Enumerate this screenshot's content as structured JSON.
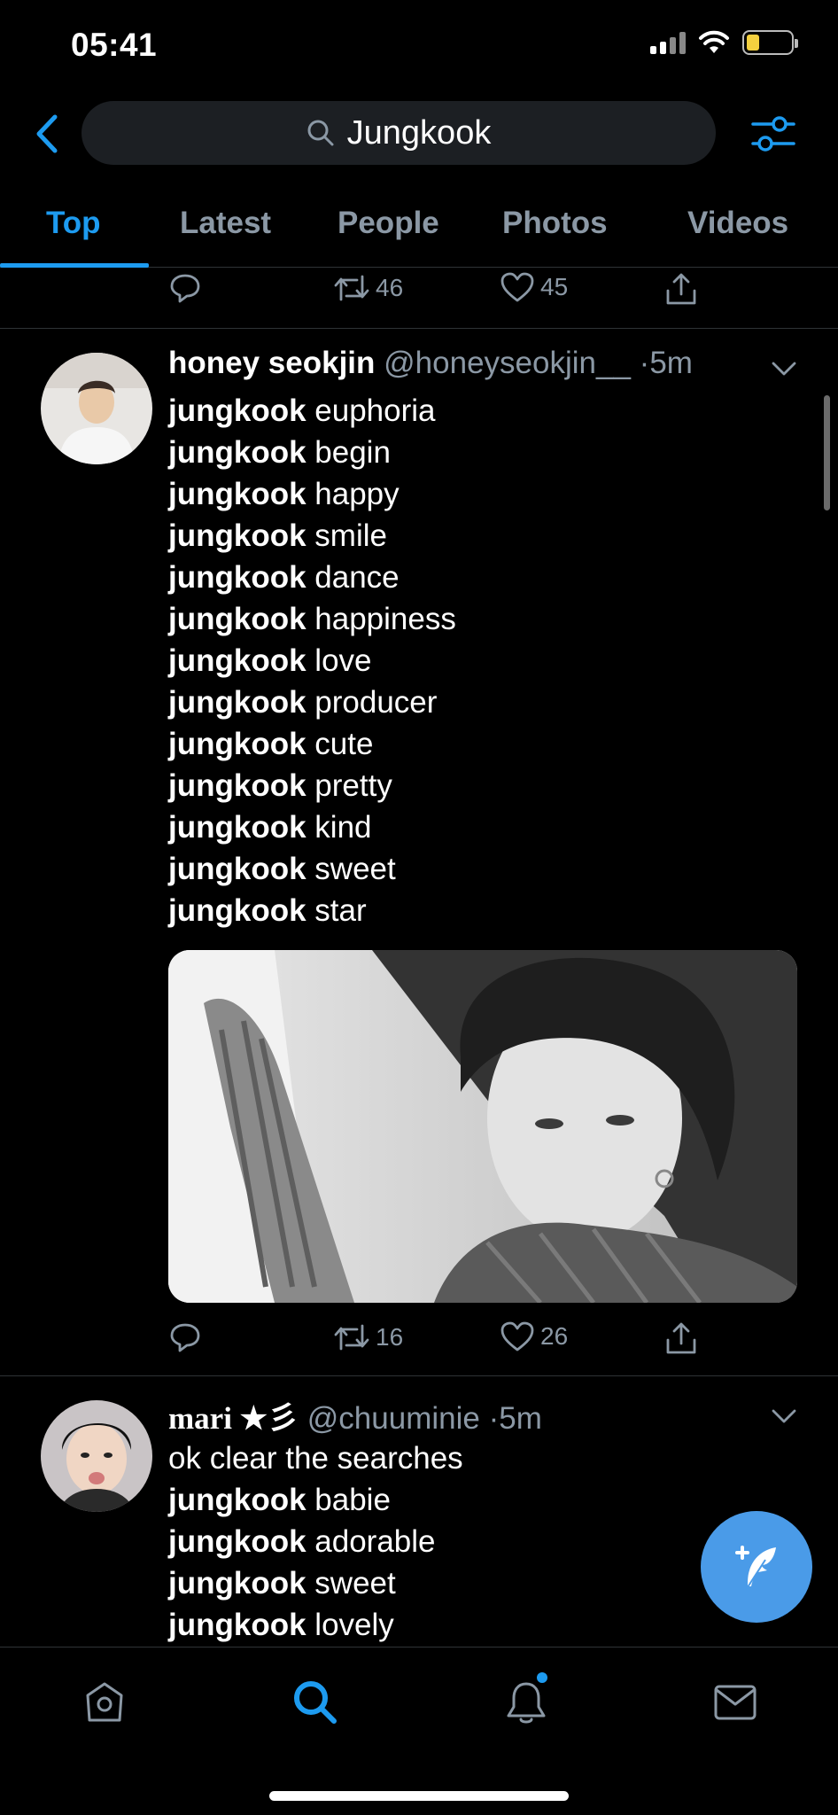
{
  "status_bar": {
    "time": "05:41"
  },
  "search": {
    "query": "Jungkook"
  },
  "tabs": [
    {
      "label": "Top",
      "active": true
    },
    {
      "label": "Latest",
      "active": false
    },
    {
      "label": "People",
      "active": false
    },
    {
      "label": "Photos",
      "active": false
    },
    {
      "label": "Videos",
      "active": false
    }
  ],
  "prev_tweet_actions": {
    "retweets": "46",
    "likes": "45"
  },
  "tweets": [
    {
      "name": "honey seokjin",
      "handle": "@honeyseokjin__",
      "dot": "·",
      "ago": "5m",
      "lines": [
        {
          "bold": "jungkook",
          "rest": " euphoria"
        },
        {
          "bold": "jungkook",
          "rest": " begin"
        },
        {
          "bold": "jungkook",
          "rest": " happy"
        },
        {
          "bold": "jungkook",
          "rest": " smile"
        },
        {
          "bold": "jungkook",
          "rest": " dance"
        },
        {
          "bold": "jungkook",
          "rest": " happiness"
        },
        {
          "bold": "jungkook",
          "rest": " love"
        },
        {
          "bold": "jungkook",
          "rest": " producer"
        },
        {
          "bold": "jungkook",
          "rest": " cute"
        },
        {
          "bold": "jungkook",
          "rest": " pretty"
        },
        {
          "bold": "jungkook",
          "rest": " kind"
        },
        {
          "bold": "jungkook",
          "rest": " sweet"
        },
        {
          "bold": "jungkook",
          "rest": " star"
        }
      ],
      "retweets": "16",
      "likes": "26"
    },
    {
      "name": "mari ★彡",
      "handle": "@chuuminie",
      "dot": "·",
      "ago": "5m",
      "lines": [
        {
          "bold": "",
          "rest": "ok clear the searches"
        },
        {
          "bold": "jungkook",
          "rest": " babie"
        },
        {
          "bold": "jungkook",
          "rest": " adorable"
        },
        {
          "bold": "jungkook",
          "rest": " sweet"
        },
        {
          "bold": "jungkook",
          "rest": " lovely"
        }
      ]
    }
  ],
  "colors": {
    "accent": "#1d9bf0",
    "fab": "#4a9be8",
    "muted": "#8b98a5",
    "background": "#000000"
  },
  "icons": {
    "back": "chevron-left-icon",
    "search": "search-icon",
    "filter": "filter-sliders-icon",
    "reply": "reply-icon",
    "retweet": "retweet-icon",
    "like": "heart-icon",
    "share": "share-icon",
    "compose": "compose-feather-icon",
    "home": "home-icon",
    "explore": "search-icon",
    "notifications": "bell-icon",
    "messages": "mail-icon"
  }
}
